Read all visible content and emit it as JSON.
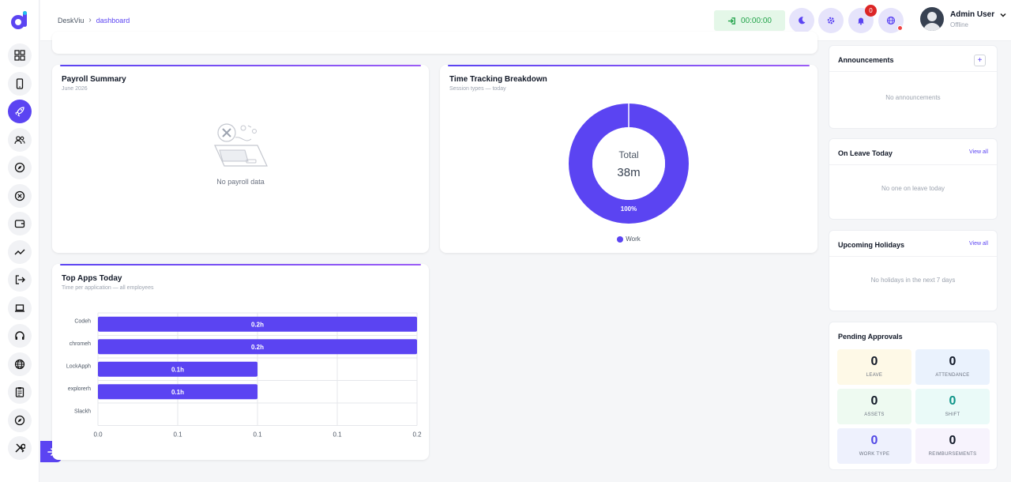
{
  "breadcrumb": {
    "home": "DeskViu",
    "current": "dashboard"
  },
  "timer": {
    "value": "00:00:00"
  },
  "notifications": {
    "count": "0"
  },
  "user": {
    "name": "Admin User",
    "status": "Offline"
  },
  "sidebar": {
    "items": [
      {
        "icon": "grid-icon"
      },
      {
        "icon": "phone-icon"
      },
      {
        "icon": "rocket-icon",
        "active": true
      },
      {
        "icon": "users-icon"
      },
      {
        "icon": "compass-icon"
      },
      {
        "icon": "cancel-circle-icon"
      },
      {
        "icon": "wallet-icon"
      },
      {
        "icon": "trend-icon"
      },
      {
        "icon": "logout-icon"
      },
      {
        "icon": "laptop-icon"
      },
      {
        "icon": "headset-icon"
      },
      {
        "icon": "globe-icon"
      },
      {
        "icon": "clipboard-icon"
      },
      {
        "icon": "compass-icon"
      },
      {
        "icon": "tools-icon"
      }
    ]
  },
  "payroll": {
    "title": "Payroll Summary",
    "subtitle": "June 2026",
    "empty": "No payroll data"
  },
  "time_tracking": {
    "title": "Time Tracking Breakdown",
    "subtitle": "Session types — today",
    "center_label": "Total",
    "center_value": "38m",
    "slice_label": "100%",
    "legend": "Work",
    "color": "#5b44f2"
  },
  "top_apps": {
    "title": "Top Apps Today",
    "subtitle": "Time per application — all employees"
  },
  "chart_data": {
    "type": "bar",
    "orientation": "horizontal",
    "categories": [
      "Codeh",
      "chromeh",
      "LockApph",
      "explorerh",
      "Slackh"
    ],
    "values": [
      0.2,
      0.2,
      0.1,
      0.1,
      0
    ],
    "data_labels": [
      "0.2h",
      "0.2h",
      "0.1h",
      "0.1h",
      ""
    ],
    "x_ticks": [
      "0.0",
      "0.1",
      "0.1",
      "0.1",
      "0.2"
    ],
    "xlim": [
      0,
      0.2
    ],
    "color": "#5b44f2",
    "grid": true
  },
  "announcements": {
    "title": "Announcements",
    "plus": "+",
    "empty": "No announcements"
  },
  "on_leave": {
    "title": "On Leave Today",
    "link": "View all",
    "empty": "No one on leave today"
  },
  "holidays": {
    "title": "Upcoming Holidays",
    "link": "View all",
    "empty": "No holidays in the next 7 days"
  },
  "approvals": {
    "title": "Pending Approvals",
    "tiles": [
      {
        "value": "0",
        "label": "LEAVE",
        "bg": "#fef9e7",
        "color": "#111827"
      },
      {
        "value": "0",
        "label": "ATTENDANCE",
        "bg": "#eaf2fd",
        "color": "#111827"
      },
      {
        "value": "0",
        "label": "ASSETS",
        "bg": "#eefaf1",
        "color": "#111827"
      },
      {
        "value": "0",
        "label": "SHIFT",
        "bg": "#eafaf8",
        "color": "#0d9488"
      },
      {
        "value": "0",
        "label": "WORK TYPE",
        "bg": "#eef1fd",
        "color": "#4f46e5"
      },
      {
        "value": "0",
        "label": "REIMBURSEMENTS",
        "bg": "#f7f3fd",
        "color": "#111827"
      }
    ]
  }
}
